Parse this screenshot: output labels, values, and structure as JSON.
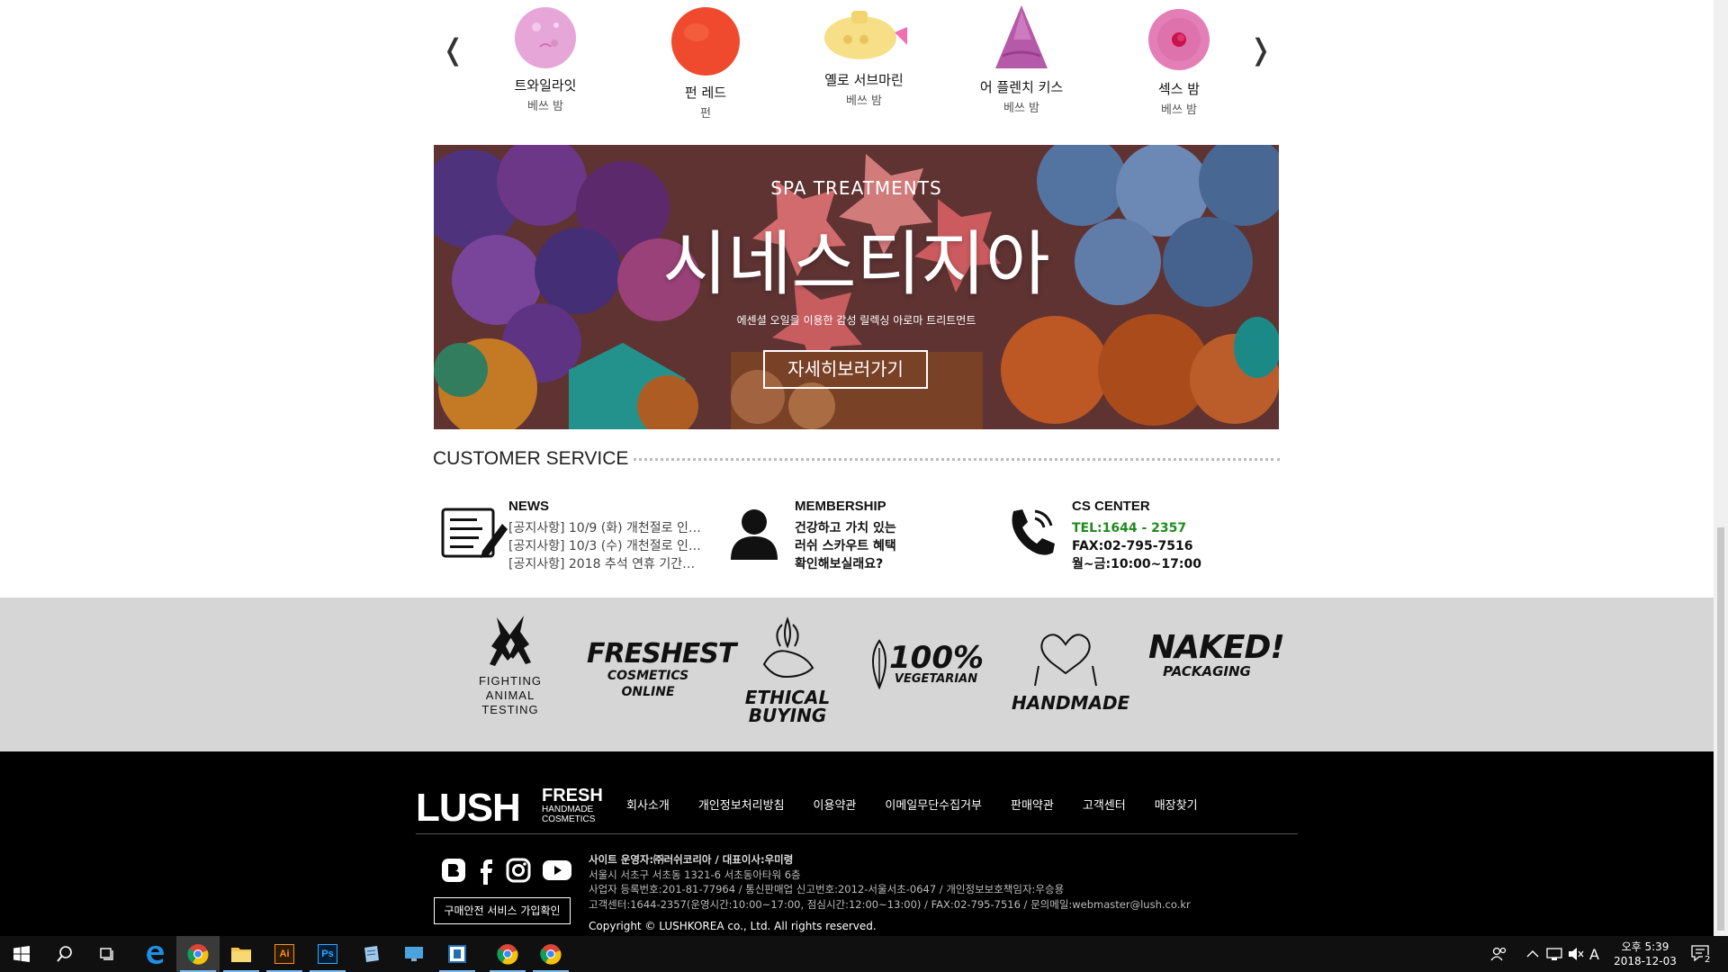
{
  "carousel": {
    "prev_glyph": "❬",
    "next_glyph": "❭",
    "items": [
      {
        "name": "트와일라잇",
        "category": "베쓰 밤"
      },
      {
        "name": "펀 레드",
        "category": "펀"
      },
      {
        "name": "옐로 서브마린",
        "category": "베쓰 밤"
      },
      {
        "name": "어 플렌치 키스",
        "category": "베쓰 밤"
      },
      {
        "name": "섹스 밤",
        "category": "베쓰 밤"
      }
    ]
  },
  "banner": {
    "kicker": "SPA TREATMENTS",
    "title": "시네스티지아",
    "desc": "에센셜 오일을 이용한 감성 릴렉싱 아로마 트리트먼트",
    "button": "자세히보러가기"
  },
  "customer_service": {
    "heading": "CUSTOMER SERVICE",
    "news": {
      "title": "NEWS",
      "items": [
        "[공지사항] 10/9 (화) 개천절로 인…",
        "[공지사항] 10/3 (수) 개천절로 인…",
        "[공지사항] 2018 추석 연휴 기간…"
      ]
    },
    "membership": {
      "title": "MEMBERSHIP",
      "lines": [
        "건강하고 가치 있는",
        "러쉬 스카우트 혜택",
        "확인해보실래요?"
      ]
    },
    "cs_center": {
      "title": "CS CENTER",
      "tel": "TEL:1644 - 2357",
      "fax": "FAX:02-795-7516",
      "hours": "월~금:10:00~17:00"
    }
  },
  "values": {
    "fighting": [
      "FIGHTING",
      "ANIMAL",
      "TESTING"
    ],
    "freshest": [
      "FRESHEST",
      "COSMETICS ONLINE"
    ],
    "ethical": "ETHICAL BUYING",
    "vegetarian": [
      "100%",
      "VEGETARIAN"
    ],
    "handmade": "HANDMADE",
    "naked": [
      "NAKED!",
      "PACKAGING"
    ]
  },
  "footer": {
    "logo": {
      "brand": "LUSH",
      "fresh": "FRESH",
      "handmade": "HANDMADE",
      "cosmetics": "COSMETICS"
    },
    "nav": [
      "회사소개",
      "개인정보처리방침",
      "이용약관",
      "이메일무단수집거부",
      "판매약관",
      "고객센터",
      "매장찾기"
    ],
    "info": [
      "사이트 운영자:㈜러쉬코리아 / 대표이사:우미령",
      "서울시 서초구 서초동 1321-6 서초동아타워 6층",
      "사업자 등록번호:201-81-77964 / 통신판매업 신고번호:2012-서울서초-0647 / 개인정보보호책임자:우승용",
      "고객센터:1644-2357(운영시간:10:00~17:00, 점심시간:12:00~13:00) / FAX:02-795-7516 / 문의메일:webmaster@lush.co.kr"
    ],
    "safe_button": "구매안전 서비스 가입확인",
    "copyright": "Copyright © LUSHKOREA co., Ltd. All rights reserved."
  },
  "taskbar": {
    "clock_time": "오후 5:39",
    "clock_date": "2018-12-03",
    "ime": "A",
    "notifications": "2",
    "app_labels": {
      "illustrator": "Ai",
      "photoshop": "Ps"
    }
  }
}
